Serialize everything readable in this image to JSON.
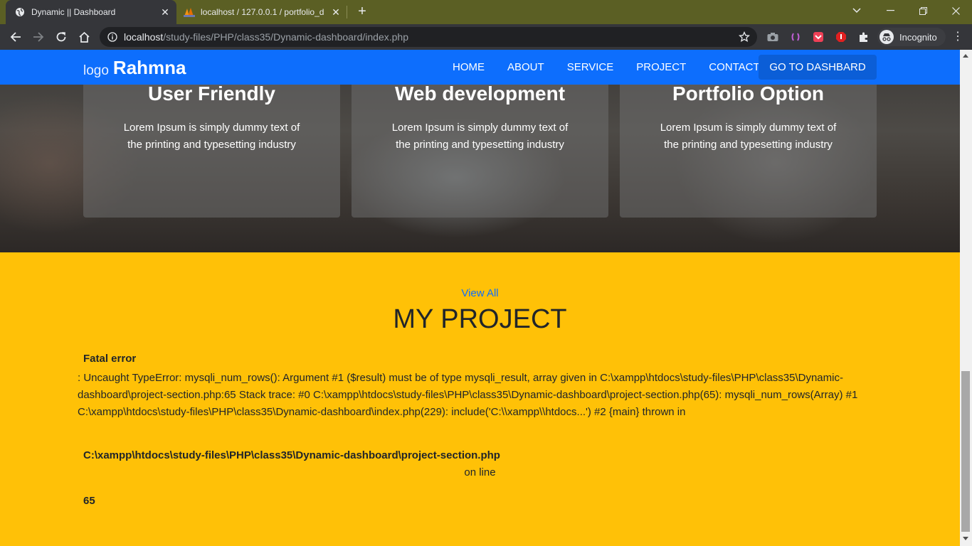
{
  "browser": {
    "tabs": [
      {
        "title": "Dynamic || Dashboard",
        "icon": "globe-icon",
        "active": true
      },
      {
        "title": "localhost / 127.0.0.1 / portfolio_d",
        "icon": "phpmyadmin-icon",
        "active": false
      }
    ],
    "url": {
      "host": "localhost",
      "path": "/study-files/PHP/class35/Dynamic-dashboard/index.php"
    },
    "profile_label": "Incognito"
  },
  "site": {
    "logo_alt": "logo",
    "brand": "Rahmna",
    "nav": [
      "HOME",
      "ABOUT",
      "SERVICE",
      "PROJECT",
      "CONTACT"
    ],
    "dashboard_button": "GO TO DASHBARD",
    "primary_color": "#0d6efd"
  },
  "services": [
    {
      "title": "User Friendly",
      "text": "Lorem Ipsum is simply dummy text of the printing and typesetting industry"
    },
    {
      "title": "Web development",
      "text": "Lorem Ipsum is simply dummy text of the printing and typesetting industry"
    },
    {
      "title": "Portfolio Option",
      "text": "Lorem Ipsum is simply dummy text of the printing and typesetting industry"
    }
  ],
  "project": {
    "view_all": "View All",
    "title": "MY PROJECT",
    "background_color": "#ffc107",
    "error": {
      "heading": "Fatal error",
      "message": ": Uncaught TypeError: mysqli_num_rows(): Argument #1 ($result) must be of type mysqli_result, array given in C:\\xampp\\htdocs\\study-files\\PHP\\class35\\Dynamic-dashboard\\project-section.php:65 Stack trace: #0 C:\\xampp\\htdocs\\study-files\\PHP\\class35\\Dynamic-dashboard\\project-section.php(65): mysqli_num_rows(Array) #1 C:\\xampp\\htdocs\\study-files\\PHP\\class35\\Dynamic-dashboard\\index.php(229): include('C:\\\\xampp\\\\htdocs...') #2 {main} thrown in",
      "file": "C:\\xampp\\htdocs\\study-files\\PHP\\class35\\Dynamic-dashboard\\project-section.php",
      "on_line": "on line",
      "line": "65"
    }
  }
}
